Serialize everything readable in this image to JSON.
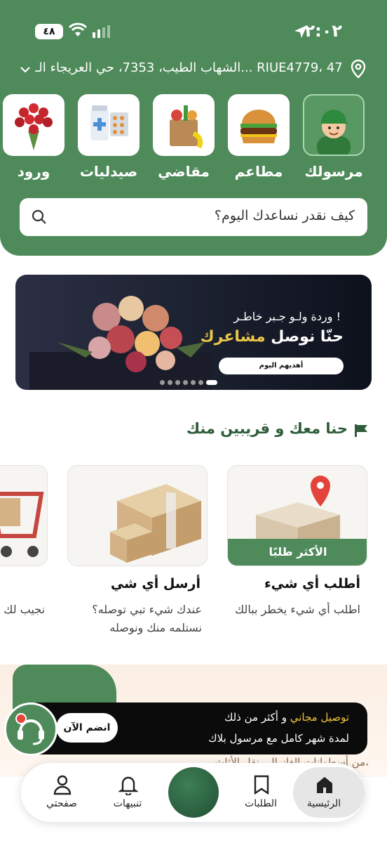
{
  "status": {
    "time": "٢:٠٢",
    "battery": "٤٨"
  },
  "address": {
    "text": "الشهاب الطيب، 7353، حي العريجاء الـ... RIUE4779، 4779"
  },
  "categories": [
    {
      "label": "مرسولك",
      "icon": "courier-icon"
    },
    {
      "label": "مطاعم",
      "icon": "burger-icon"
    },
    {
      "label": "مقاضي",
      "icon": "grocery-bag-icon"
    },
    {
      "label": "صيدليات",
      "icon": "pharmacy-icon"
    },
    {
      "label": "ورود",
      "icon": "flowers-icon"
    }
  ],
  "search": {
    "placeholder": "كيف نقدر نساعدك اليوم؟"
  },
  "banner": {
    "subtitle": "وردة ولـو جـبر خاطـر !",
    "title_main": "حنّا نوصل ",
    "title_accent": "مشاعرك",
    "button": "أهديهم اليوم",
    "dots_count": 7,
    "active_dot": 0
  },
  "section": {
    "title": "حنا معك و قريبين منك"
  },
  "cards": [
    {
      "title": "أطلب أي شيء",
      "desc1": "اطلب أي شيء يخطر ببالك",
      "desc2": "",
      "badge": "الأكثر طلبًا"
    },
    {
      "title": "أرسل أي شي",
      "desc1": "عندك شيء تبي توصله؟",
      "desc2": "نستلمه منك ونوصله",
      "badge": ""
    },
    {
      "title": "",
      "desc1": "نجيب لك",
      "desc2": "",
      "badge": ""
    }
  ],
  "promo": {
    "line1_accent": "توصيل مجاني",
    "line1_rest": " و أكثر من ذلك",
    "line2": "لمدة شهر كامل مع مرسول بلاك",
    "join": "انضم الآن",
    "under": "من أسطوانات الغاز الى نقل الأثاث،"
  },
  "tabs": [
    {
      "label": "الرئيسية",
      "icon": "home-icon"
    },
    {
      "label": "الطلبات",
      "icon": "orders-icon"
    },
    {
      "label": "تنبيهات",
      "icon": "bell-icon"
    },
    {
      "label": "صفحتي",
      "icon": "profile-icon"
    }
  ],
  "colors": {
    "brand_green": "#4f8a5a",
    "accent_gold": "#e9c64a",
    "section_green": "#2f5d3a"
  }
}
